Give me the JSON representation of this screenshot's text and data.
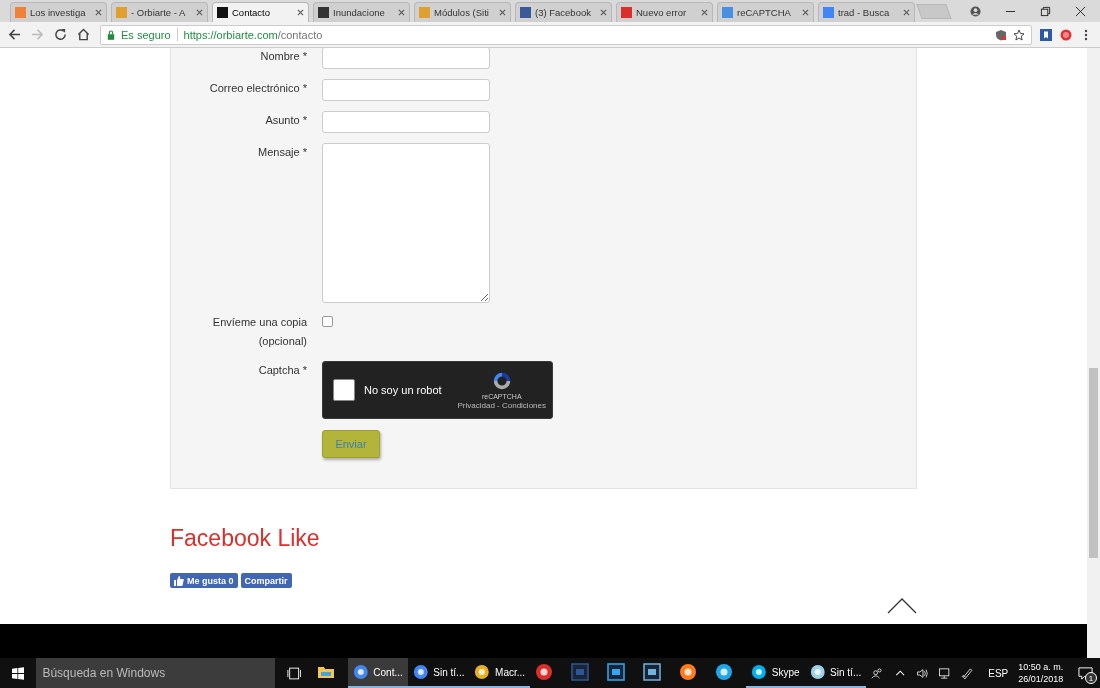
{
  "tabs": [
    {
      "label": "Los investiga",
      "color": "#f0813a",
      "selected": false
    },
    {
      "label": "- Orbiarte - A",
      "color": "#e0a030",
      "selected": false
    },
    {
      "label": "Contacto",
      "color": "#111111",
      "selected": true
    },
    {
      "label": "Inundacione",
      "color": "#333333",
      "selected": false
    },
    {
      "label": "Módulos (Siti",
      "color": "#e0a030",
      "selected": false
    },
    {
      "label": "(3) Facebook",
      "color": "#3b5998",
      "selected": false
    },
    {
      "label": "Nuevo error",
      "color": "#d9302c",
      "selected": false
    },
    {
      "label": "reCAPTCHA",
      "color": "#4a90e2",
      "selected": false
    },
    {
      "label": "trad - Busca",
      "color": "#4285f4",
      "selected": false
    }
  ],
  "address": {
    "secure_label": "Es seguro",
    "host": "https://orbiarte.com",
    "path": "/contacto"
  },
  "form": {
    "fields": [
      {
        "label": "Nombre *",
        "kind": "input"
      },
      {
        "label": "Correo electrónico *",
        "kind": "input"
      },
      {
        "label": "Asunto *",
        "kind": "input"
      },
      {
        "label": "Mensaje *",
        "kind": "textarea"
      },
      {
        "label": "Envíeme una copia (opcional)",
        "kind": "checkbox",
        "checked": false
      },
      {
        "label": "Captcha *",
        "kind": "captcha",
        "checked": false,
        "text": "No soy un robot",
        "brand": "reCAPTCHA",
        "links": "Privacidad - Condiciones"
      }
    ],
    "submit": "Enviar"
  },
  "facebook": {
    "heading": "Facebook Like",
    "like": "Me gusta",
    "count": "0",
    "share": "Compartir"
  },
  "taskbar": {
    "search_placeholder": "Búsqueda en Windows",
    "apps": [
      {
        "kind": "explorer",
        "running": false,
        "selected": false
      },
      {
        "kind": "chrome",
        "label": "Cont...",
        "running": true,
        "selected": true
      },
      {
        "kind": "chrome",
        "label": "Sin tí...",
        "running": true,
        "selected": false
      },
      {
        "kind": "macromedia",
        "label": "Macr...",
        "running": true,
        "selected": false
      },
      {
        "kind": "sketchup",
        "running": false,
        "selected": false
      },
      {
        "kind": "word",
        "running": false,
        "selected": false
      },
      {
        "kind": "photoshop",
        "running": false,
        "selected": false
      },
      {
        "kind": "lightroom",
        "running": false,
        "selected": false
      },
      {
        "kind": "firefox",
        "running": false,
        "selected": false
      },
      {
        "kind": "ie",
        "running": false,
        "selected": false
      },
      {
        "kind": "skype",
        "label": "Skype",
        "running": true,
        "selected": false
      },
      {
        "kind": "notepad",
        "label": "Sin tí...",
        "running": true,
        "selected": false
      }
    ],
    "language": "ESP",
    "time": "10:50 a. m.",
    "date": "26/01/2018",
    "notifications": "1"
  }
}
